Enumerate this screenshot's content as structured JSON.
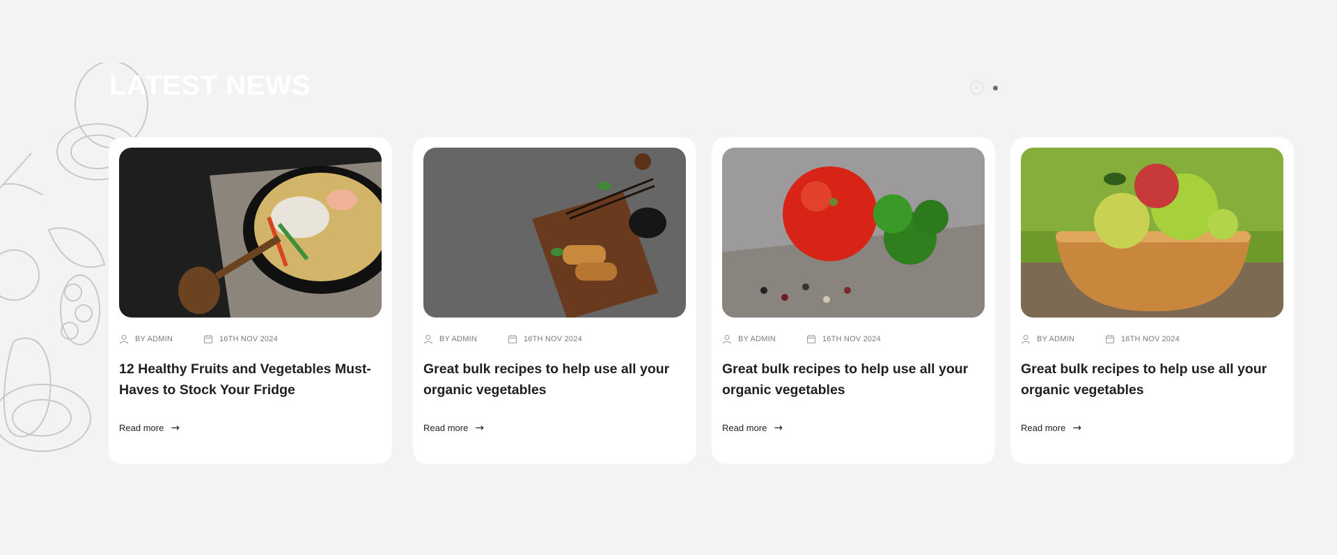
{
  "section": {
    "title": "LATEST NEWS"
  },
  "pagination": {
    "active_index": 0,
    "count": 2
  },
  "colors": {
    "background": "#f3f3f3",
    "card": "#ffffff",
    "text": "#1f1f1f",
    "meta_text": "#7a7a7a"
  },
  "posts": [
    {
      "image": "noodle-bowl-photo",
      "author": "BY ADMIN",
      "date": "16TH NOV 2024",
      "title": "12 Healthy Fruits and Vegetables Must-Haves to Stock Your Fridge",
      "read_more": "Read more"
    },
    {
      "image": "spring-rolls-board-photo",
      "author": "BY ADMIN",
      "date": "16TH NOV 2024",
      "title": "Great bulk recipes to help use all your organic vegetables",
      "read_more": "Read more"
    },
    {
      "image": "tomato-parsley-photo",
      "author": "BY ADMIN",
      "date": "16TH NOV 2024",
      "title": "Great bulk recipes to help use all your organic vegetables",
      "read_more": "Read more"
    },
    {
      "image": "apples-bowl-photo",
      "author": "BY ADMIN",
      "date": "16TH NOV 2024",
      "title": "Great bulk recipes to help use all your organic vegetables",
      "read_more": "Read more"
    }
  ]
}
